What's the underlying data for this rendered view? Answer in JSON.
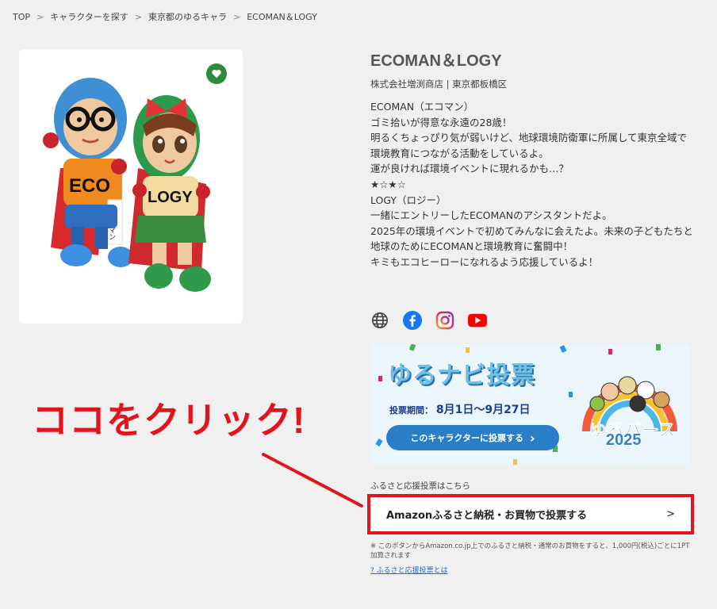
{
  "breadcrumb": [
    "TOP",
    "キャラクターを探す",
    "東京都のゆるキャラ",
    "ECOMAN＆LOGY"
  ],
  "breadcrumb_separator": ">",
  "character": {
    "name": "ECOMAN＆LOGY",
    "org": "株式会社増渕商店 | 東京都板橋区",
    "image_texts": {
      "eco_badge": "ECO",
      "logy_badge": "LOGY",
      "sash": "エコマン"
    },
    "description": [
      "ECOMAN（エコマン）",
      "ゴミ拾いが得意な永遠の28歳！",
      "明るくちょっぴり気が弱いけど、地球環境防衛軍に所属して東京全域で環境教育につながる活動をしているよ。",
      "運が良ければ環境イベントに現れるかも…？",
      "★☆★☆",
      "LOGY（ロジー）",
      "一緒にエントリーしたECOMANのアシスタントだよ。",
      "2025年の環境イベントで初めてみんなに会えたよ。未来の子どもたちと地球のためにECOMANと環境教育に奮闘中！",
      "キミもエコヒーローになれるよう応援しているよ！"
    ]
  },
  "social_icons": [
    "globe-icon",
    "facebook-icon",
    "instagram-icon",
    "youtube-icon"
  ],
  "banner": {
    "title": "ゆるナビ投票",
    "period_label": "投票期間：",
    "period_value": "8月1日～9月27日",
    "button_label": "このキャラクターに投票する",
    "button_arrow": "›",
    "logo_text": "ゆるバース",
    "logo_year": "2025"
  },
  "support": {
    "label": "ふるさと応援投票はこちら",
    "button_label": "Amazonふるさと納税・お買物で投票する",
    "button_arrow": ">",
    "note": "※ このボタンからAmazon.co.jp上でのふるさと納税・通常のお買物をすると、1,000円(税込)ごとに1PT加算されます",
    "help_link": "? ふるさと応援投票とは"
  },
  "annotation": {
    "text": "ココをクリック!"
  },
  "colors": {
    "background": "#f0f0f0",
    "accent_red": "#e0151d",
    "favorite_green": "#2e8b3a",
    "banner_blue": "#2a7ec6"
  }
}
